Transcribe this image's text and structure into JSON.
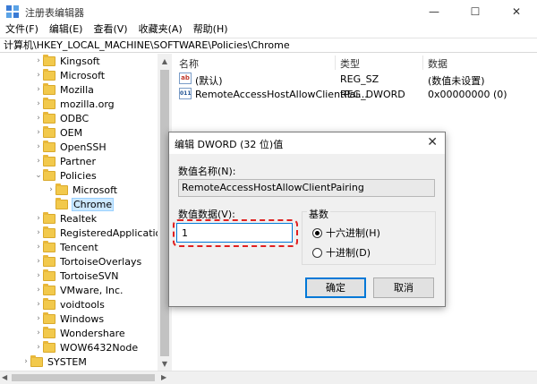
{
  "window": {
    "title": "注册表编辑器",
    "minimize_glyph": "—",
    "maximize_glyph": "☐",
    "close_glyph": "✕"
  },
  "menu": [
    "文件(F)",
    "编辑(E)",
    "查看(V)",
    "收藏夹(A)",
    "帮助(H)"
  ],
  "address": "计算机\\HKEY_LOCAL_MACHINE\\SOFTWARE\\Policies\\Chrome",
  "tree": {
    "items": [
      {
        "label": "Kingsoft",
        "expanded": false
      },
      {
        "label": "Microsoft",
        "expanded": false
      },
      {
        "label": "Mozilla",
        "expanded": false
      },
      {
        "label": "mozilla.org",
        "expanded": false
      },
      {
        "label": "ODBC",
        "expanded": false
      },
      {
        "label": "OEM",
        "expanded": false
      },
      {
        "label": "OpenSSH",
        "expanded": false
      },
      {
        "label": "Partner",
        "expanded": false
      },
      {
        "label": "Policies",
        "expanded": true
      },
      {
        "label": "Microsoft",
        "expanded": false
      },
      {
        "label": "Chrome",
        "selected": true
      },
      {
        "label": "Realtek",
        "expanded": false
      },
      {
        "label": "RegisteredApplication",
        "expanded": false
      },
      {
        "label": "Tencent",
        "expanded": false
      },
      {
        "label": "TortoiseOverlays",
        "expanded": false
      },
      {
        "label": "TortoiseSVN",
        "expanded": false
      },
      {
        "label": "VMware, Inc.",
        "expanded": false
      },
      {
        "label": "voidtools",
        "expanded": false
      },
      {
        "label": "Windows",
        "expanded": false
      },
      {
        "label": "Wondershare",
        "expanded": false
      },
      {
        "label": "WOW6432Node",
        "expanded": false
      },
      {
        "label": "SYSTEM",
        "expanded": false
      }
    ]
  },
  "list": {
    "headers": {
      "name": "名称",
      "type": "类型",
      "data": "数据"
    },
    "rows": [
      {
        "icon": "string-value-icon",
        "icon_text": "ab",
        "name": "(默认)",
        "type": "REG_SZ",
        "data": "(数值未设置)"
      },
      {
        "icon": "binary-value-icon",
        "icon_text": "011",
        "name": "RemoteAccessHostAllowClientPai...",
        "type": "REG_DWORD",
        "data": "0x00000000 (0)"
      }
    ]
  },
  "dialog": {
    "title": "编辑 DWORD (32 位)值",
    "close_glyph": "✕",
    "name_label": "数值名称(N):",
    "name_value": "RemoteAccessHostAllowClientPairing",
    "data_label": "数值数据(V):",
    "data_value": "1",
    "base_label": "基数",
    "radio_hex": "十六进制(H)",
    "radio_dec": "十进制(D)",
    "ok": "确定",
    "cancel": "取消"
  },
  "colors": {
    "selection": "#cce8ff",
    "accent": "#0078d7",
    "highlight": "#e02020"
  }
}
